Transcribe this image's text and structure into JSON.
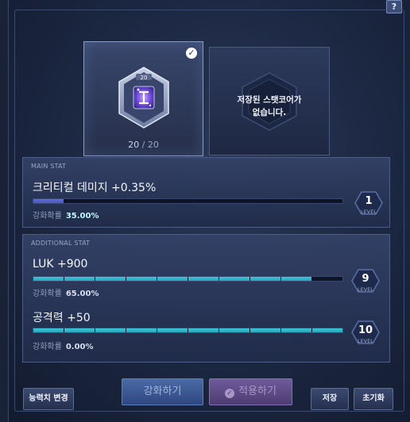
{
  "help_label": "?",
  "core": {
    "level_label": "20",
    "count_current": "20",
    "count_sep": " / ",
    "count_max": "20"
  },
  "saved": {
    "text": "저장된 스탯코어가\n없습니다."
  },
  "main_stat": {
    "section_label": "MAIN STAT",
    "name": "크리티컬 데미지 +0.35%",
    "rate_label": "강화확률",
    "rate_value": "35.00%",
    "level": "1",
    "level_caption": "LEVEL",
    "progress": 0.1
  },
  "additional_stat": {
    "section_label": "ADDITIONAL STAT",
    "stats": [
      {
        "name": "LUK +900",
        "rate_label": "강화확률",
        "rate_value": "65.00%",
        "level": "9",
        "level_caption": "LEVEL",
        "progress": 0.9
      },
      {
        "name": "공격력 +50",
        "rate_label": "강화확률",
        "rate_value": "0.00%",
        "level": "10",
        "level_caption": "LEVEL",
        "progress": 1.0
      }
    ]
  },
  "buttons": {
    "enhance": "강화하기",
    "apply": "적용하기",
    "ability_change": "능력치 변경",
    "save": "저장",
    "reset": "초기화"
  },
  "colors": {
    "main_bar": "#5b6be0",
    "add_bar": "#37c7dc",
    "accent_cyan": "#bff6ff"
  }
}
